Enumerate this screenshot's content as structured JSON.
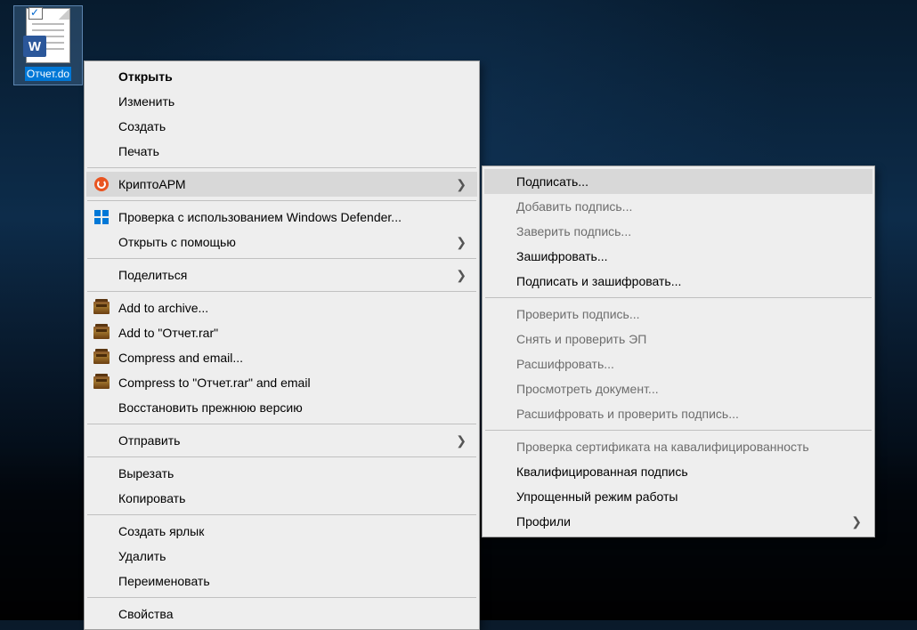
{
  "file": {
    "label": "Отчет.do",
    "badge": "W"
  },
  "menu1": {
    "items": [
      {
        "id": "open",
        "label": "Открыть",
        "bold": true
      },
      {
        "id": "edit",
        "label": "Изменить"
      },
      {
        "id": "create",
        "label": "Создать"
      },
      {
        "id": "print",
        "label": "Печать"
      },
      {
        "sep": true
      },
      {
        "id": "cryptoarm",
        "label": "КриптоАРМ",
        "icon": "orange",
        "submenu": true,
        "highlighted": true
      },
      {
        "sep": true
      },
      {
        "id": "defender",
        "label": "Проверка с использованием Windows Defender...",
        "icon": "defender"
      },
      {
        "id": "openwith",
        "label": "Открыть с помощью",
        "submenu": true
      },
      {
        "sep": true
      },
      {
        "id": "share",
        "label": "Поделиться",
        "submenu": true
      },
      {
        "sep": true
      },
      {
        "id": "addarchive",
        "label": "Add to archive...",
        "icon": "rar"
      },
      {
        "id": "addtorar",
        "label": "Add to \"Отчет.rar\"",
        "icon": "rar"
      },
      {
        "id": "compressemail",
        "label": "Compress and email...",
        "icon": "rar"
      },
      {
        "id": "compresstorar",
        "label": "Compress to \"Отчет.rar\" and email",
        "icon": "rar"
      },
      {
        "id": "restore",
        "label": "Восстановить прежнюю версию"
      },
      {
        "sep": true
      },
      {
        "id": "sendto",
        "label": "Отправить",
        "submenu": true
      },
      {
        "sep": true
      },
      {
        "id": "cut",
        "label": "Вырезать"
      },
      {
        "id": "copy",
        "label": "Копировать"
      },
      {
        "sep": true
      },
      {
        "id": "shortcut",
        "label": "Создать ярлык"
      },
      {
        "id": "delete",
        "label": "Удалить"
      },
      {
        "id": "rename",
        "label": "Переименовать"
      },
      {
        "sep": true
      },
      {
        "id": "properties",
        "label": "Свойства"
      }
    ]
  },
  "menu2": {
    "items": [
      {
        "id": "sign",
        "label": "Подписать...",
        "highlighted": true
      },
      {
        "id": "addsig",
        "label": "Добавить подпись...",
        "disabled": true
      },
      {
        "id": "certsig",
        "label": "Заверить подпись...",
        "disabled": true
      },
      {
        "id": "encrypt",
        "label": "Зашифровать..."
      },
      {
        "id": "signencrypt",
        "label": "Подписать и зашифровать..."
      },
      {
        "sep": true
      },
      {
        "id": "verifysig",
        "label": "Проверить подпись...",
        "disabled": true
      },
      {
        "id": "removeverify",
        "label": "Снять и проверить ЭП",
        "disabled": true
      },
      {
        "id": "decrypt",
        "label": "Расшифровать...",
        "disabled": true
      },
      {
        "id": "viewdoc",
        "label": "Просмотреть документ...",
        "disabled": true
      },
      {
        "id": "decryptverify",
        "label": "Расшифровать и проверить подпись...",
        "disabled": true
      },
      {
        "sep": true
      },
      {
        "id": "checkcert",
        "label": "Проверка сертификата на кавалифицированность",
        "disabled": true
      },
      {
        "id": "qualsig",
        "label": "Квалифицированная подпись"
      },
      {
        "id": "simplemode",
        "label": "Упрощенный режим работы"
      },
      {
        "id": "profiles",
        "label": "Профили",
        "submenu": true
      }
    ]
  }
}
